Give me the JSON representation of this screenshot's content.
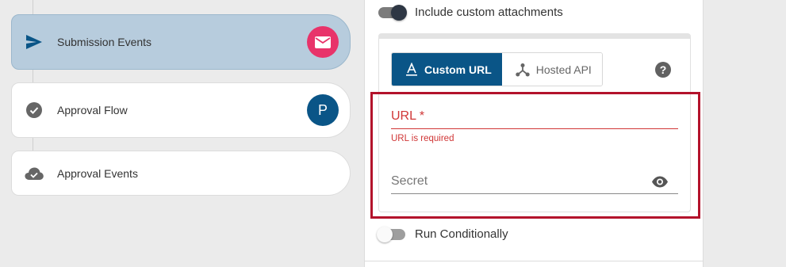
{
  "steps": [
    {
      "label": "Submission Events",
      "icon": "send-icon",
      "avatar_icon": "mail-icon",
      "avatar_color": "#e8336a",
      "active": true
    },
    {
      "label": "Approval Flow",
      "icon": "check-circle-icon",
      "avatar_text": "P",
      "avatar_color": "#0a5587",
      "active": false
    },
    {
      "label": "Approval Events",
      "icon": "cloud-check-icon",
      "active": false
    }
  ],
  "panel": {
    "include_attachments": {
      "label": "Include custom attachments",
      "on": true
    },
    "tabs": [
      {
        "label": "Custom URL",
        "icon": "text-format-icon",
        "active": true
      },
      {
        "label": "Hosted API",
        "icon": "hub-icon",
        "active": false
      }
    ],
    "help_icon": "?",
    "url_field": {
      "label": "URL *",
      "error": "URL is required",
      "value": ""
    },
    "secret_field": {
      "label": "Secret",
      "value": "",
      "icon": "eye-icon"
    },
    "run_conditionally": {
      "label": "Run Conditionally",
      "on": false
    }
  },
  "colors": {
    "primary": "#0a5587",
    "active_step_bg": "#b7ccdd",
    "error": "#d03636",
    "highlight": "#b3122b",
    "toggle_on_track": "#7b7b7b",
    "toggle_on_thumb": "#2e3744",
    "toggle_off_track": "#9e9e9e",
    "toggle_off_thumb": "#fafafa"
  }
}
